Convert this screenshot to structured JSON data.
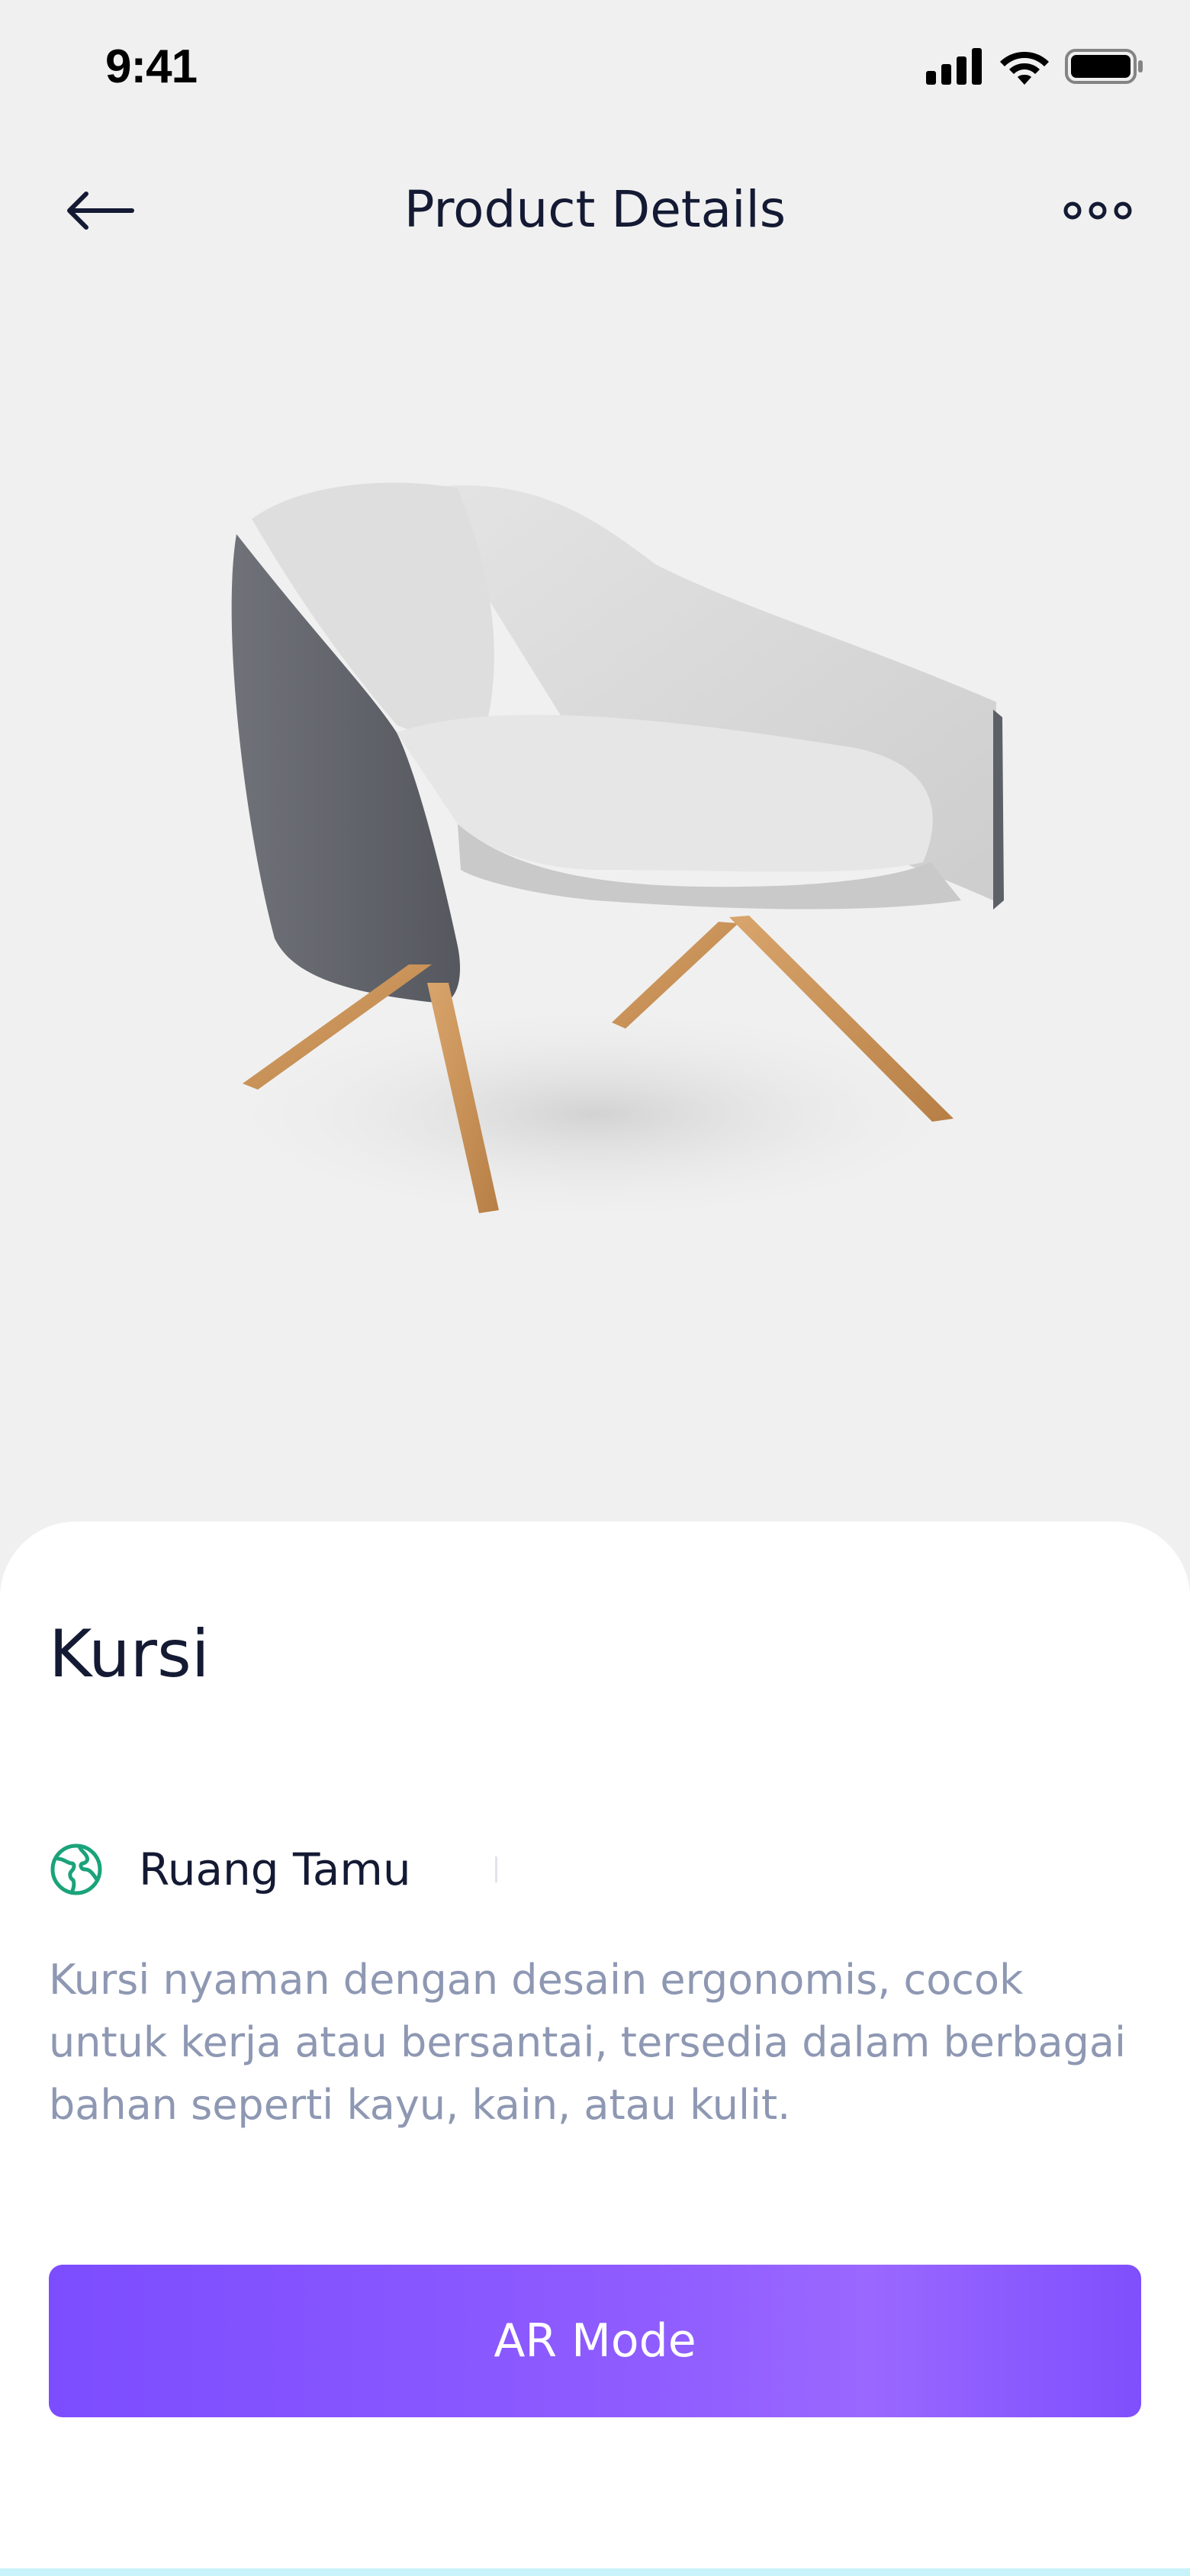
{
  "status_bar": {
    "time": "9:41",
    "icons": [
      "cellular-signal-icon",
      "wifi-icon",
      "battery-icon"
    ]
  },
  "nav": {
    "back_icon": "arrow-left-icon",
    "title": "Product Details",
    "more_icon": "more-dots-icon"
  },
  "product": {
    "image": "armchair-image",
    "name": "Kursi",
    "category_icon": "globe-icon",
    "category": "Ruang Tamu",
    "description": "Kursi nyaman dengan desain ergonomis, cocok untuk kerja atau bersantai, tersedia dalam berbagai bahan seperti kayu, kain, atau kulit."
  },
  "actions": {
    "ar_button_label": "AR Mode"
  },
  "colors": {
    "background": "#f0f0f0",
    "text_primary": "#141a33",
    "text_secondary": "#8e98b3",
    "accent": "#8752ff",
    "category_icon": "#1aa37a"
  }
}
